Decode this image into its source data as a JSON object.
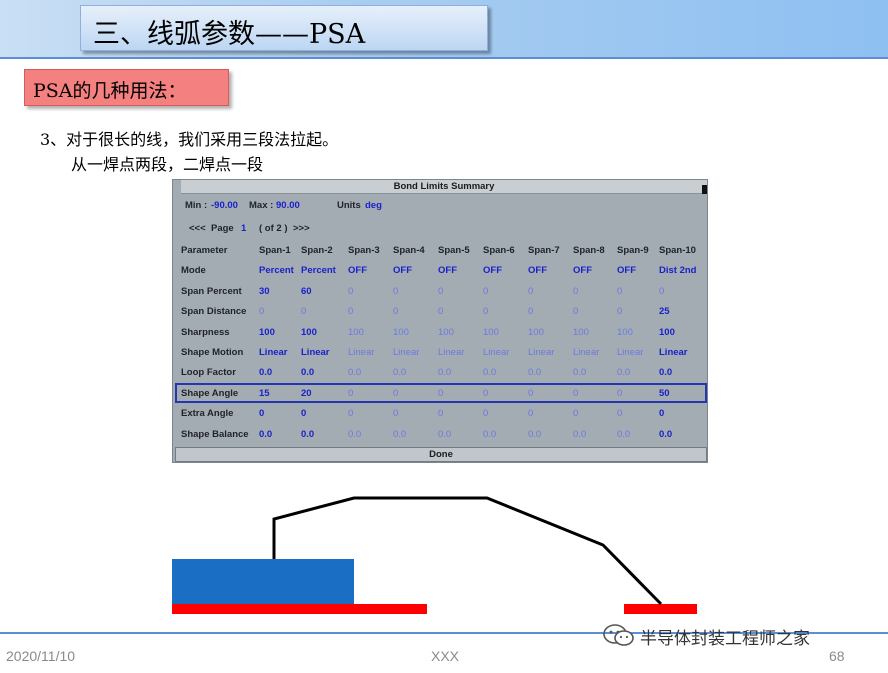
{
  "title": "三、线弧参数——PSA",
  "subtitle": "PSA的几种用法：",
  "description": {
    "line1": "3、对于很长的线，我们采用三段法拉起。",
    "line2": "从一焊点两段，二焊点一段"
  },
  "panel": {
    "title": "Bond Limits Summary",
    "min_label": "Min :",
    "min_value": "-90.00",
    "max_label": "Max :",
    "max_value": "90.00",
    "units_label": "Units",
    "units_value": "deg",
    "page_prev": "<<<",
    "page_label": "Page",
    "page_number": "1",
    "page_of": "( of 2 )",
    "page_next": ">>>",
    "done_label": "Done",
    "headers": [
      "Parameter",
      "Span-1",
      "Span-2",
      "Span-3",
      "Span-4",
      "Span-5",
      "Span-6",
      "Span-7",
      "Span-8",
      "Span-9",
      "Span-10"
    ],
    "rows": [
      {
        "label": "Mode",
        "cells": [
          "Percent",
          "Percent",
          "OFF",
          "OFF",
          "OFF",
          "OFF",
          "OFF",
          "OFF",
          "OFF",
          "Dist 2nd"
        ],
        "dim": [
          false,
          false,
          false,
          false,
          false,
          false,
          false,
          false,
          false,
          false
        ]
      },
      {
        "label": "Span Percent",
        "cells": [
          "30",
          "60",
          "0",
          "0",
          "0",
          "0",
          "0",
          "0",
          "0",
          "0"
        ],
        "dim": [
          false,
          false,
          true,
          true,
          true,
          true,
          true,
          true,
          true,
          true
        ]
      },
      {
        "label": "Span Distance",
        "cells": [
          "0",
          "0",
          "0",
          "0",
          "0",
          "0",
          "0",
          "0",
          "0",
          "25"
        ],
        "dim": [
          true,
          true,
          true,
          true,
          true,
          true,
          true,
          true,
          true,
          false
        ]
      },
      {
        "label": "Sharpness",
        "cells": [
          "100",
          "100",
          "100",
          "100",
          "100",
          "100",
          "100",
          "100",
          "100",
          "100"
        ],
        "dim": [
          false,
          false,
          true,
          true,
          true,
          true,
          true,
          true,
          true,
          false
        ]
      },
      {
        "label": "Shape Motion",
        "cells": [
          "Linear",
          "Linear",
          "Linear",
          "Linear",
          "Linear",
          "Linear",
          "Linear",
          "Linear",
          "Linear",
          "Linear"
        ],
        "dim": [
          false,
          false,
          true,
          true,
          true,
          true,
          true,
          true,
          true,
          false
        ]
      },
      {
        "label": "Loop Factor",
        "cells": [
          "0.0",
          "0.0",
          "0.0",
          "0.0",
          "0.0",
          "0.0",
          "0.0",
          "0.0",
          "0.0",
          "0.0"
        ],
        "dim": [
          false,
          false,
          true,
          true,
          true,
          true,
          true,
          true,
          true,
          false
        ]
      },
      {
        "label": "Shape Angle",
        "cells": [
          "15",
          "20",
          "0",
          "0",
          "0",
          "0",
          "0",
          "0",
          "0",
          "50"
        ],
        "dim": [
          false,
          false,
          true,
          true,
          true,
          true,
          true,
          true,
          true,
          false
        ]
      },
      {
        "label": "Extra Angle",
        "cells": [
          "0",
          "0",
          "0",
          "0",
          "0",
          "0",
          "0",
          "0",
          "0",
          "0"
        ],
        "dim": [
          false,
          false,
          true,
          true,
          true,
          true,
          true,
          true,
          true,
          false
        ]
      },
      {
        "label": "Shape Balance",
        "cells": [
          "0.0",
          "0.0",
          "0.0",
          "0.0",
          "0.0",
          "0.0",
          "0.0",
          "0.0",
          "0.0",
          "0.0"
        ],
        "dim": [
          false,
          false,
          true,
          true,
          true,
          true,
          true,
          true,
          true,
          false
        ]
      }
    ]
  },
  "diagram": {
    "die_color": "#1a6fc4",
    "substrate_color": "#ff0000",
    "wire_color": "#000000"
  },
  "footer": {
    "date": "2020/11/10",
    "center": "XXX",
    "page": "68",
    "watermark": "半导体封装工程师之家"
  }
}
